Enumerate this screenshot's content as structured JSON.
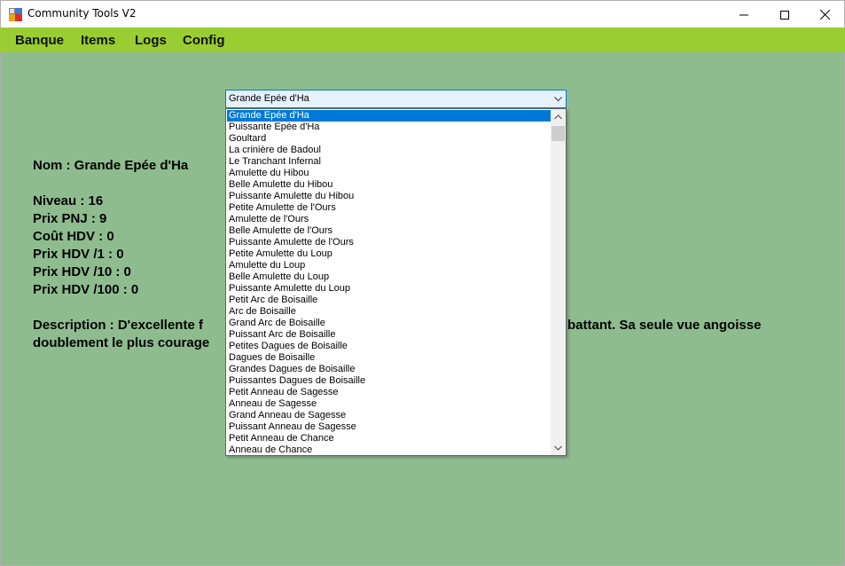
{
  "window": {
    "title": "Community Tools V2",
    "controls": [
      "minimize",
      "maximize",
      "close"
    ]
  },
  "menu": {
    "items": [
      "Banque",
      "Items",
      "Logs",
      "Config"
    ]
  },
  "combo": {
    "selected": "Grande Epée d'Ha"
  },
  "dropdown": {
    "selected_index": 0,
    "options": [
      "Grande Epée d'Ha",
      "Puissante Epée d'Ha",
      "Goultard",
      "La crinière de Badoul",
      "Le Tranchant Infernal",
      "Amulette du Hibou",
      "Belle Amulette du Hibou",
      "Puissante Amulette du Hibou",
      "Petite Amulette de l'Ours",
      "Amulette de l'Ours",
      "Belle Amulette de l'Ours",
      "Puissante Amulette de l'Ours",
      "Petite Amulette du Loup",
      "Amulette du Loup",
      "Belle Amulette du Loup",
      "Puissante Amulette du Loup",
      "Petit Arc de Boisaille",
      "Arc de Boisaille",
      "Grand Arc de Boisaille",
      "Puissant Arc de Boisaille",
      "Petites Dagues de Boisaille",
      "Dagues de Boisaille",
      "Grandes Dagues de Boisaille",
      "Puissantes Dagues de Boisaille",
      "Petit Anneau de Sagesse",
      "Anneau de Sagesse",
      "Grand Anneau de Sagesse",
      "Puissant Anneau de Sagesse",
      "Petit Anneau de Chance",
      "Anneau de Chance"
    ]
  },
  "details": {
    "nom": "Nom : Grande Epée d'Ha",
    "niveau": "Niveau : 16",
    "prix_pnj": "Prix PNJ : 9",
    "cout_hdv": "Coût HDV : 0",
    "prix_hdv_1": "Prix HDV /1 : 0",
    "prix_hdv_10": "Prix HDV /10 : 0",
    "prix_hdv_100": "Prix HDV /100 : 0",
    "description_left_1": "Description : D'excellente f",
    "description_right_1": "battant. Sa seule vue angoisse",
    "description_left_2": "doublement le plus courage"
  },
  "colors": {
    "menubar": "#9acd32",
    "background": "#8fbc8f",
    "selection": "#0078d7"
  }
}
